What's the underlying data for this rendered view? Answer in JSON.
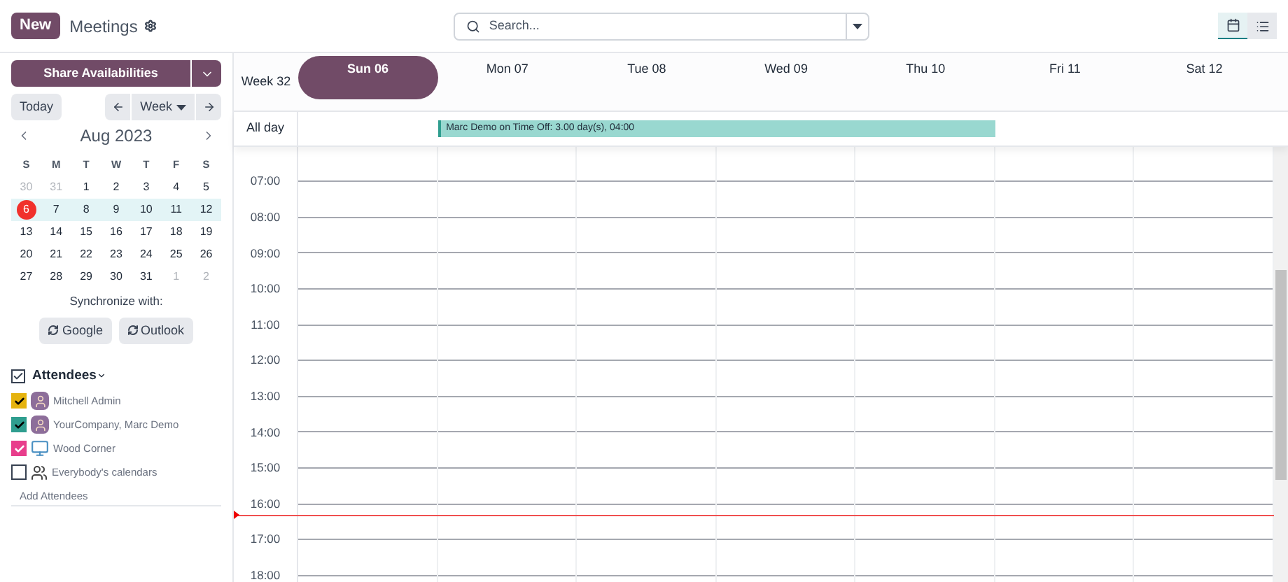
{
  "top_bar": {
    "new_button": "New",
    "title": "Meetings",
    "search": {
      "placeholder": "Search..."
    },
    "views": [
      {
        "kind": "calendar",
        "selected": true
      },
      {
        "kind": "list",
        "selected": false
      }
    ]
  },
  "sidebar": {
    "share_button": "Share Availabilities",
    "today_button": "Today",
    "scale_button": "Week",
    "mini_calendar": {
      "month": "Aug 2023",
      "weekdays": [
        "S",
        "M",
        "T",
        "W",
        "T",
        "F",
        "S"
      ],
      "weeks": [
        {
          "selected": false,
          "days": [
            {
              "label": "30",
              "other_month": true,
              "today": false
            },
            {
              "label": "31",
              "other_month": true,
              "today": false
            },
            {
              "label": "1",
              "other_month": false,
              "today": false
            },
            {
              "label": "2",
              "other_month": false,
              "today": false
            },
            {
              "label": "3",
              "other_month": false,
              "today": false
            },
            {
              "label": "4",
              "other_month": false,
              "today": false
            },
            {
              "label": "5",
              "other_month": false,
              "today": false
            }
          ]
        },
        {
          "selected": true,
          "days": [
            {
              "label": "6",
              "other_month": false,
              "today": true
            },
            {
              "label": "7",
              "other_month": false,
              "today": false
            },
            {
              "label": "8",
              "other_month": false,
              "today": false
            },
            {
              "label": "9",
              "other_month": false,
              "today": false
            },
            {
              "label": "10",
              "other_month": false,
              "today": false
            },
            {
              "label": "11",
              "other_month": false,
              "today": false
            },
            {
              "label": "12",
              "other_month": false,
              "today": false
            }
          ]
        },
        {
          "selected": false,
          "days": [
            {
              "label": "13",
              "other_month": false,
              "today": false
            },
            {
              "label": "14",
              "other_month": false,
              "today": false
            },
            {
              "label": "15",
              "other_month": false,
              "today": false
            },
            {
              "label": "16",
              "other_month": false,
              "today": false
            },
            {
              "label": "17",
              "other_month": false,
              "today": false
            },
            {
              "label": "18",
              "other_month": false,
              "today": false
            },
            {
              "label": "19",
              "other_month": false,
              "today": false
            }
          ]
        },
        {
          "selected": false,
          "days": [
            {
              "label": "20",
              "other_month": false,
              "today": false
            },
            {
              "label": "21",
              "other_month": false,
              "today": false
            },
            {
              "label": "22",
              "other_month": false,
              "today": false
            },
            {
              "label": "23",
              "other_month": false,
              "today": false
            },
            {
              "label": "24",
              "other_month": false,
              "today": false
            },
            {
              "label": "25",
              "other_month": false,
              "today": false
            },
            {
              "label": "26",
              "other_month": false,
              "today": false
            }
          ]
        },
        {
          "selected": false,
          "days": [
            {
              "label": "27",
              "other_month": false,
              "today": false
            },
            {
              "label": "28",
              "other_month": false,
              "today": false
            },
            {
              "label": "29",
              "other_month": false,
              "today": false
            },
            {
              "label": "30",
              "other_month": false,
              "today": false
            },
            {
              "label": "31",
              "other_month": false,
              "today": false
            },
            {
              "label": "1",
              "other_month": true,
              "today": false
            },
            {
              "label": "2",
              "other_month": true,
              "today": false
            }
          ]
        }
      ]
    },
    "sync": {
      "label": "Synchronize with:",
      "buttons": [
        "Google",
        "Outlook"
      ]
    },
    "attendees": {
      "label": "Attendees",
      "checked": true,
      "items": [
        {
          "name": "Mitchell Admin",
          "checked": true,
          "color": "#e5b30e",
          "kind": "person"
        },
        {
          "name": "YourCompany, Marc Demo",
          "checked": true,
          "color": "#2f9e8f",
          "kind": "person"
        },
        {
          "name": "Wood Corner",
          "checked": true,
          "color": "#e83e8c",
          "kind": "company"
        },
        {
          "name": "Everybody's calendars",
          "checked": false,
          "color": "#ffffff",
          "kind": "group"
        }
      ],
      "add_link": "Add Attendees"
    }
  },
  "calendar": {
    "week_label": "Week 32",
    "days": [
      {
        "label": "Sun 06",
        "selected": true
      },
      {
        "label": "Mon 07",
        "selected": false
      },
      {
        "label": "Tue 08",
        "selected": false
      },
      {
        "label": "Wed 09",
        "selected": false
      },
      {
        "label": "Thu 10",
        "selected": false
      },
      {
        "label": "Fri 11",
        "selected": false
      },
      {
        "label": "Sat 12",
        "selected": false
      }
    ],
    "all_day_label": "All day",
    "all_day_events": [
      {
        "title": "Marc Demo on Time Off: 3.00 day(s), 04:00",
        "color": "#99d8d0"
      }
    ],
    "hours": [
      "07:00",
      "08:00",
      "09:00",
      "10:00",
      "11:00",
      "12:00",
      "13:00",
      "14:00",
      "15:00",
      "16:00",
      "17:00",
      "18:00"
    ]
  }
}
